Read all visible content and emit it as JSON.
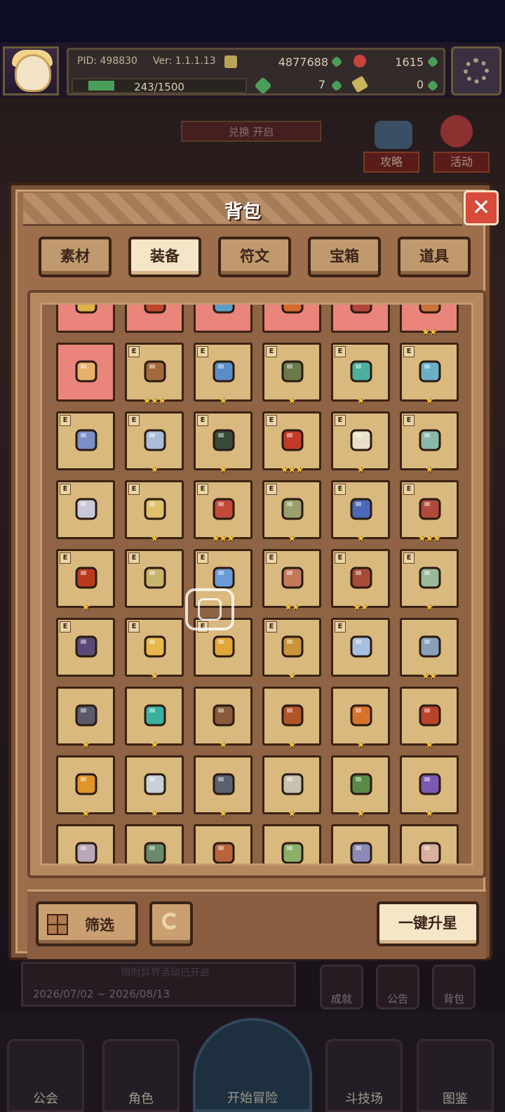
{
  "header": {
    "pid": "PID: 498830",
    "version": "Ver: 1.1.1.13",
    "gold": "4877688",
    "gems": "1615",
    "exp": "243/1500",
    "exp_fraction": 0.162,
    "clover_count": "7",
    "key_count": "0"
  },
  "background": {
    "banner": "兑换 开启",
    "side_buttons": [
      "攻略",
      "活动"
    ],
    "event_date": "2026/07/02 ~ 2026/08/13",
    "event_note": "限时异界活动已开启",
    "mini_buttons": [
      "成就",
      "公告",
      "背包"
    ],
    "nav": [
      "公会",
      "角色",
      "开始冒险",
      "斗技场",
      "图鉴"
    ]
  },
  "panel": {
    "title": "背包",
    "close_icon": "close-icon",
    "tabs": [
      "素材",
      "装备",
      "符文",
      "宝箱",
      "道具"
    ],
    "active_tab": "装备",
    "filter_label": "筛选",
    "upstar_label": "一键升星"
  },
  "items": [
    {
      "row": 0,
      "col": 0,
      "bg": "pink",
      "icon": "#e0b24a",
      "stars": ""
    },
    {
      "row": 0,
      "col": 1,
      "bg": "pink",
      "icon": "#c2442c",
      "stars": ""
    },
    {
      "row": 0,
      "col": 2,
      "bg": "pink",
      "icon": "#5a9ec8",
      "stars": ""
    },
    {
      "row": 0,
      "col": 3,
      "bg": "pink",
      "icon": "#d66a2c",
      "stars": ""
    },
    {
      "row": 0,
      "col": 4,
      "bg": "pink",
      "icon": "#b2443a",
      "stars": ""
    },
    {
      "row": 0,
      "col": 5,
      "bg": "pink",
      "icon": "#c8743a",
      "stars": "★★"
    },
    {
      "row": 1,
      "col": 0,
      "bg": "pink",
      "icon": "#e8b06a",
      "stars": "",
      "e": false
    },
    {
      "row": 1,
      "col": 1,
      "bg": "gold",
      "icon": "#a26a3a",
      "stars": "★★★",
      "e": true
    },
    {
      "row": 1,
      "col": 2,
      "bg": "gold",
      "icon": "#5a8ec8",
      "stars": "★",
      "e": true
    },
    {
      "row": 1,
      "col": 3,
      "bg": "gold",
      "icon": "#6a7a4a",
      "stars": "★",
      "e": true
    },
    {
      "row": 1,
      "col": 4,
      "bg": "gold",
      "icon": "#4ab0a0",
      "stars": "★",
      "e": true
    },
    {
      "row": 1,
      "col": 5,
      "bg": "gold",
      "icon": "#6ab0c8",
      "stars": "★",
      "e": true
    },
    {
      "row": 2,
      "col": 0,
      "bg": "gold",
      "icon": "#7a8ec8",
      "stars": "",
      "e": true
    },
    {
      "row": 2,
      "col": 1,
      "bg": "gold",
      "icon": "#aabcd8",
      "stars": "★",
      "e": true
    },
    {
      "row": 2,
      "col": 2,
      "bg": "gold",
      "icon": "#3a4a3a",
      "stars": "★",
      "e": true
    },
    {
      "row": 2,
      "col": 3,
      "bg": "gold",
      "icon": "#c23a2a",
      "stars": "★★★",
      "e": true
    },
    {
      "row": 2,
      "col": 4,
      "bg": "gold",
      "icon": "#e8e0c8",
      "stars": "★",
      "e": true
    },
    {
      "row": 2,
      "col": 5,
      "bg": "gold",
      "icon": "#8ab8a8",
      "stars": "★",
      "e": true
    },
    {
      "row": 3,
      "col": 0,
      "bg": "gold",
      "icon": "#c8c8d8",
      "stars": "",
      "e": true
    },
    {
      "row": 3,
      "col": 1,
      "bg": "gold",
      "icon": "#e0c06a",
      "stars": "★",
      "e": true
    },
    {
      "row": 3,
      "col": 2,
      "bg": "gold",
      "icon": "#c24a3a",
      "stars": "★★★",
      "e": true
    },
    {
      "row": 3,
      "col": 3,
      "bg": "gold",
      "icon": "#9aa06a",
      "stars": "★",
      "e": true
    },
    {
      "row": 3,
      "col": 4,
      "bg": "gold",
      "icon": "#4a6ab8",
      "stars": "★",
      "e": true
    },
    {
      "row": 3,
      "col": 5,
      "bg": "gold",
      "icon": "#b04a3a",
      "stars": "★★★",
      "e": true
    },
    {
      "row": 4,
      "col": 0,
      "bg": "gold",
      "icon": "#b83a1a",
      "stars": "★",
      "e": true
    },
    {
      "row": 4,
      "col": 1,
      "bg": "gold",
      "icon": "#c8b46a",
      "stars": "",
      "e": true
    },
    {
      "row": 4,
      "col": 2,
      "bg": "gold",
      "icon": "#6a9ad8",
      "stars": "",
      "e": true
    },
    {
      "row": 4,
      "col": 3,
      "bg": "gold",
      "icon": "#c27a5a",
      "stars": "★★",
      "e": true
    },
    {
      "row": 4,
      "col": 4,
      "bg": "gold",
      "icon": "#a84a3a",
      "stars": "★★",
      "e": true
    },
    {
      "row": 4,
      "col": 5,
      "bg": "gold",
      "icon": "#9ab89a",
      "stars": "★",
      "e": true
    },
    {
      "row": 5,
      "col": 0,
      "bg": "gold",
      "icon": "#5a4a7a",
      "stars": "",
      "e": true
    },
    {
      "row": 5,
      "col": 1,
      "bg": "gold",
      "icon": "#e8b84a",
      "stars": "★",
      "e": true
    },
    {
      "row": 5,
      "col": 2,
      "bg": "gold",
      "icon": "#e0a83a",
      "stars": "",
      "e": true
    },
    {
      "row": 5,
      "col": 3,
      "bg": "gold",
      "icon": "#c8943a",
      "stars": "★",
      "e": true
    },
    {
      "row": 5,
      "col": 4,
      "bg": "gold",
      "icon": "#a8c0e0",
      "stars": "",
      "e": true
    },
    {
      "row": 5,
      "col": 5,
      "bg": "gold",
      "icon": "#8aa0b8",
      "stars": "★★",
      "e": false
    },
    {
      "row": 6,
      "col": 0,
      "bg": "gold",
      "icon": "#5a5a6a",
      "stars": "★",
      "e": false
    },
    {
      "row": 6,
      "col": 1,
      "bg": "gold",
      "icon": "#3ab0a0",
      "stars": "★",
      "e": false
    },
    {
      "row": 6,
      "col": 2,
      "bg": "gold",
      "icon": "#8a5a3a",
      "stars": "★",
      "e": false
    },
    {
      "row": 6,
      "col": 3,
      "bg": "gold",
      "icon": "#b0542a",
      "stars": "★",
      "e": false
    },
    {
      "row": 6,
      "col": 4,
      "bg": "gold",
      "icon": "#d8742a",
      "stars": "★",
      "e": false
    },
    {
      "row": 6,
      "col": 5,
      "bg": "gold",
      "icon": "#b8442a",
      "stars": "★",
      "e": false
    },
    {
      "row": 7,
      "col": 0,
      "bg": "gold",
      "icon": "#e0942a",
      "stars": "★",
      "e": false
    },
    {
      "row": 7,
      "col": 1,
      "bg": "gold",
      "icon": "#c8d0d8",
      "stars": "★",
      "e": false
    },
    {
      "row": 7,
      "col": 2,
      "bg": "gold",
      "icon": "#5a6070",
      "stars": "★",
      "e": false
    },
    {
      "row": 7,
      "col": 3,
      "bg": "gold",
      "icon": "#c8c0b0",
      "stars": "★",
      "e": false
    },
    {
      "row": 7,
      "col": 4,
      "bg": "gold",
      "icon": "#5a8a4a",
      "stars": "★",
      "e": false
    },
    {
      "row": 7,
      "col": 5,
      "bg": "gold",
      "icon": "#7a5ab0",
      "stars": "★",
      "e": false
    },
    {
      "row": 8,
      "col": 0,
      "bg": "gold",
      "icon": "#b8a8b8",
      "stars": "",
      "e": false
    },
    {
      "row": 8,
      "col": 1,
      "bg": "gold",
      "icon": "#6a8a6a",
      "stars": "",
      "e": false
    },
    {
      "row": 8,
      "col": 2,
      "bg": "gold",
      "icon": "#b8643a",
      "stars": "",
      "e": false
    },
    {
      "row": 8,
      "col": 3,
      "bg": "gold",
      "icon": "#8ab06a",
      "stars": "",
      "e": false
    },
    {
      "row": 8,
      "col": 4,
      "bg": "gold",
      "icon": "#8a8ab8",
      "stars": "",
      "e": false
    },
    {
      "row": 8,
      "col": 5,
      "bg": "gold",
      "icon": "#d8b0a0",
      "stars": "",
      "e": false
    }
  ]
}
